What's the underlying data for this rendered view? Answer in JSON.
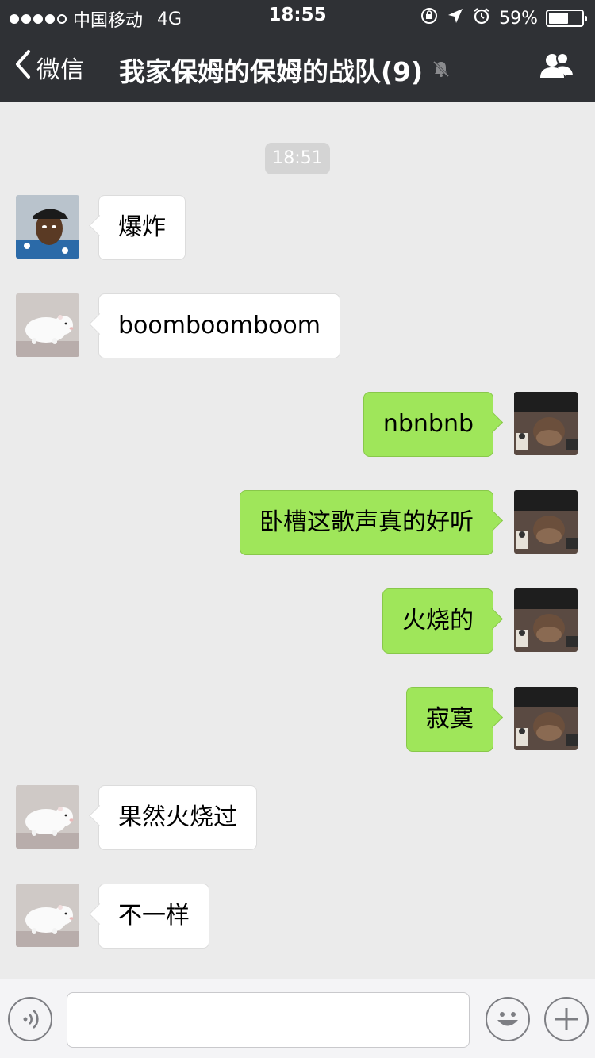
{
  "status_bar": {
    "carrier": "中国移动",
    "network": "4G",
    "time": "18:55",
    "battery_percent_text": "59%",
    "battery_level": 0.59,
    "signal_filled": 4,
    "signal_total": 5
  },
  "navbar": {
    "back_label": "微信",
    "title": "我家保姆的保姆的战队(9)",
    "muted": true
  },
  "chat": {
    "timestamp": "18:51",
    "messages": [
      {
        "side": "left",
        "avatar": "man-cap-avatar",
        "text": "爆炸"
      },
      {
        "side": "left",
        "avatar": "white-pig-avatar",
        "text": "boomboomboom"
      },
      {
        "side": "right",
        "avatar": "upside-down-photo-avatar",
        "text": "nbnbnb"
      },
      {
        "side": "right",
        "avatar": "upside-down-photo-avatar",
        "text": "卧槽这歌声真的好听"
      },
      {
        "side": "right",
        "avatar": "upside-down-photo-avatar",
        "text": "火烧的"
      },
      {
        "side": "right",
        "avatar": "upside-down-photo-avatar",
        "text": "寂寞"
      },
      {
        "side": "left",
        "avatar": "white-pig-avatar",
        "text": "果然火烧过"
      },
      {
        "side": "left",
        "avatar": "white-pig-avatar",
        "text": "不一样"
      }
    ]
  },
  "input_bar": {
    "value": "",
    "icons": [
      "voice-icon",
      "emoji-icon",
      "plus-icon"
    ]
  },
  "colors": {
    "header_bg": "#2f3135",
    "chat_bg": "#ebebeb",
    "outgoing_bubble": "#9fe65a",
    "incoming_bubble": "#ffffff"
  }
}
